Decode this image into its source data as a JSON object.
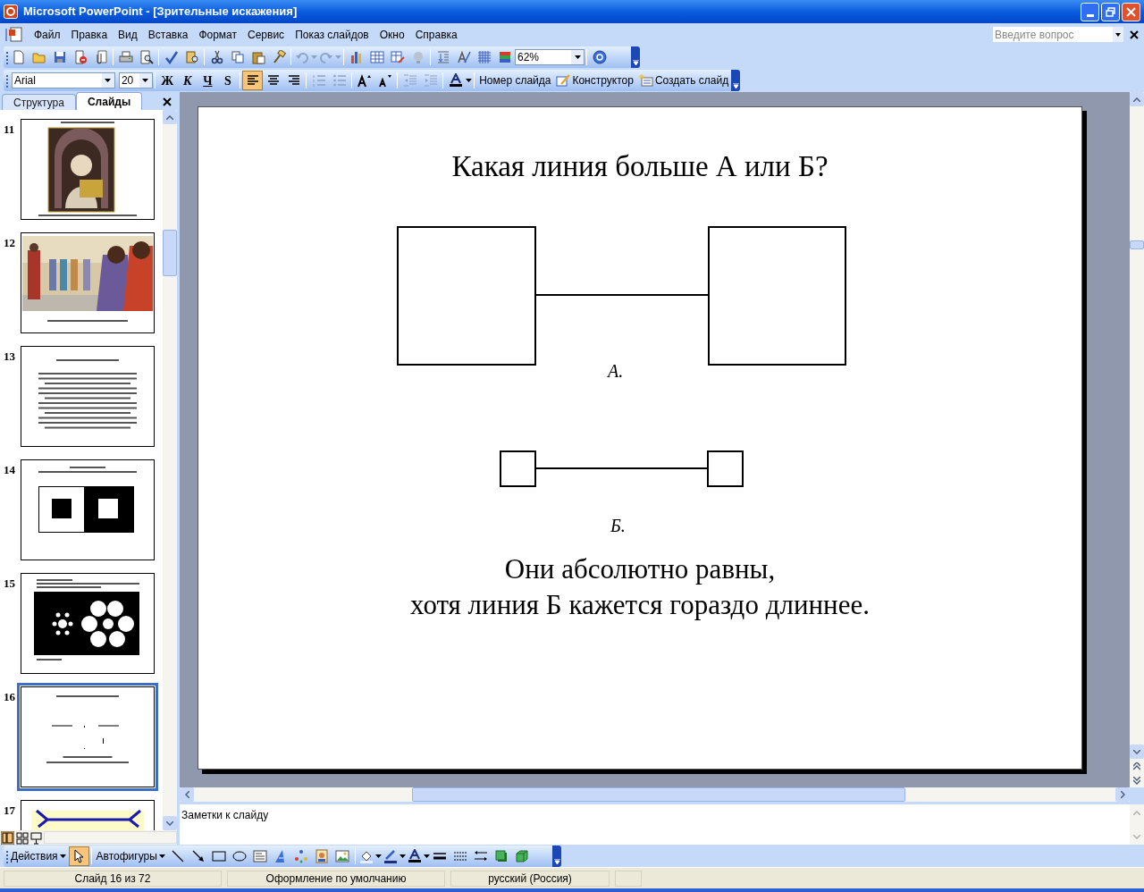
{
  "window": {
    "title": "Microsoft PowerPoint - [Зрительные искажения]"
  },
  "menu": [
    "Файл",
    "Правка",
    "Вид",
    "Вставка",
    "Формат",
    "Сервис",
    "Показ слайдов",
    "Окно",
    "Справка"
  ],
  "help_box": {
    "placeholder": "Введите вопрос"
  },
  "standard_toolbar": {
    "zoom": "62%"
  },
  "formatting_toolbar": {
    "font": "Arial",
    "size": "20",
    "style_buttons": [
      {
        "label": "Ж"
      },
      {
        "label": "К"
      },
      {
        "label": "Ч"
      },
      {
        "label": "S"
      }
    ],
    "align_buttons": [
      {
        "selected": true
      },
      {
        "selected": false
      },
      {
        "selected": false
      }
    ],
    "commands": [
      "Номер слайда",
      "Конструктор",
      "Создать слайд"
    ]
  },
  "pane_tabs": [
    {
      "label": "Структура",
      "selected": false
    },
    {
      "label": "Слайды",
      "selected": true
    }
  ],
  "thumbnails": [
    {
      "number": "11",
      "kind": "painting",
      "selected": false
    },
    {
      "number": "12",
      "kind": "crowd",
      "selected": false
    },
    {
      "number": "13",
      "kind": "text",
      "selected": false
    },
    {
      "number": "14",
      "kind": "squares",
      "selected": false
    },
    {
      "number": "15",
      "kind": "circles",
      "selected": false
    },
    {
      "number": "16",
      "kind": "lines",
      "selected": true
    },
    {
      "number": "17",
      "kind": "arrows",
      "selected": false
    }
  ],
  "slide": {
    "title": "Какая линия больше А или Б?",
    "label_a": "А.",
    "label_b": "Б.",
    "caption": [
      "Они абсолютно равны,",
      "хотя линия Б кажется гораздо длиннее."
    ]
  },
  "notes": {
    "placeholder": "Заметки к слайду"
  },
  "drawing_toolbar": {
    "actions": "Действия",
    "pointer_selected": true,
    "autoshapes": "Автофигуры"
  },
  "status_bar": [
    "Слайд 16 из 72",
    "Оформление по умолчанию",
    "русский (Россия)"
  ]
}
